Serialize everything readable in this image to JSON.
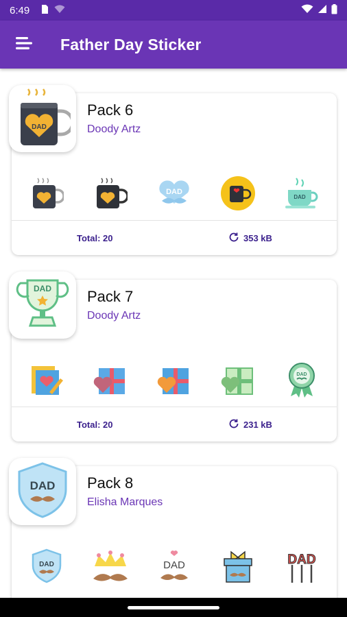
{
  "status": {
    "time": "6:49"
  },
  "app": {
    "title": "Father Day Sticker"
  },
  "packs": [
    {
      "name": "Pack 6",
      "author": "Doody Artz",
      "total": "Total: 20",
      "size": "353 kB",
      "tray_icon": "dad-mug-sticker",
      "stickers": [
        "dad-mug-sticker",
        "dad-mug-sticker",
        "dad-mustache-sticker",
        "dad-mug-badge-sticker",
        "dad-teacup-sticker"
      ]
    },
    {
      "name": "Pack 7",
      "author": "Doody Artz",
      "total": "Total: 20",
      "size": "231 kB",
      "tray_icon": "dad-trophy-sticker",
      "stickers": [
        "dad-card-sticker",
        "gift-heart-sticker",
        "gift-heart-sticker",
        "gift-heart-sticker",
        "dad-medal-sticker"
      ]
    },
    {
      "name": "Pack 8",
      "author": "Elisha Marques",
      "tray_icon": "dad-shield-sticker",
      "stickers": [
        "dad-shield-sticker",
        "crown-mustache-sticker",
        "dad-mustache-heart-sticker",
        "gift-mustache-sticker",
        "dad-balloons-sticker"
      ]
    }
  ],
  "colors": {
    "primary": "#6a35b5",
    "status_bar": "#5a2aa8",
    "accent_text": "#3a1f8c"
  }
}
